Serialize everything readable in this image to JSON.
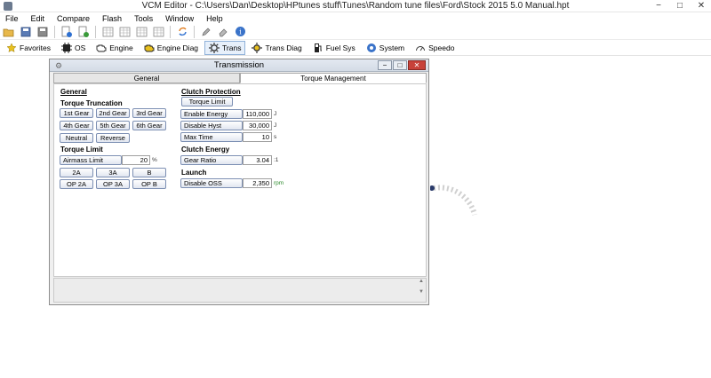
{
  "app": {
    "title": "VCM Editor - C:\\Users\\Dan\\Desktop\\HPtunes stuff\\Tunes\\Random tune files\\Ford\\Stock 2015 5.0 Manual.hpt"
  },
  "menu": [
    "File",
    "Edit",
    "Compare",
    "Flash",
    "Tools",
    "Window",
    "Help"
  ],
  "nav": {
    "favorites": "Favorites",
    "os": "OS",
    "engine": "Engine",
    "engine_diag": "Engine Diag",
    "trans": "Trans",
    "trans_diag": "Trans Diag",
    "fuel_sys": "Fuel Sys",
    "system": "System",
    "speedo": "Speedo"
  },
  "window": {
    "title": "Transmission",
    "tabs": [
      "General",
      "Torque Management"
    ],
    "active_tab": "Torque Management"
  },
  "left": {
    "general": "General",
    "torque_truncation": {
      "heading": "Torque Truncation",
      "buttons": [
        "1st Gear",
        "2nd Gear",
        "3rd Gear",
        "4th Gear",
        "5th Gear",
        "6th Gear",
        "Neutral",
        "Reverse"
      ]
    },
    "torque_limit": {
      "heading": "Torque Limit",
      "airmass_label": "Airmass Limit",
      "airmass_value": "20",
      "airmass_unit": "%",
      "buttons": [
        "2A",
        "3A",
        "B",
        "OP 2A",
        "OP 3A",
        "OP B"
      ]
    }
  },
  "right": {
    "clutch_protection": {
      "heading": "Clutch Protection",
      "torque_limit_btn": "Torque Limit",
      "fields": [
        {
          "label": "Enable Energy",
          "value": "110,000",
          "unit": "J"
        },
        {
          "label": "Disable Hyst",
          "value": "30,000",
          "unit": "J"
        },
        {
          "label": "Max Time",
          "value": "10",
          "unit": "s"
        }
      ]
    },
    "clutch_energy": {
      "heading": "Clutch Energy",
      "field": {
        "label": "Gear Ratio",
        "value": "3.04",
        "unit": ":1"
      }
    },
    "launch": {
      "heading": "Launch",
      "field": {
        "label": "Disable OSS",
        "value": "2,350",
        "unit": "rpm"
      }
    }
  },
  "colors": {
    "accent": "#7c8fb3",
    "close": "#c8423a",
    "rpm_unit": "#2e8b2e"
  }
}
